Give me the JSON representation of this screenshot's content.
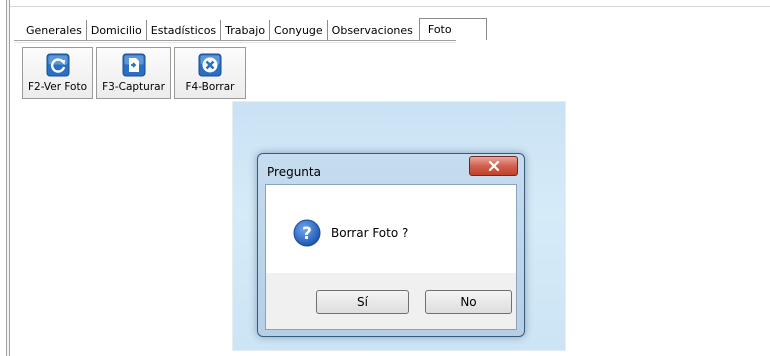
{
  "tabs": [
    "Generales",
    "Domicilio",
    "Estadísticos",
    "Trabajo",
    "Conyuge",
    "Observaciones",
    "Foto"
  ],
  "active_tab": "Foto",
  "toolbar": {
    "view_photo_label": "F2-Ver Foto",
    "capture_label": "F3-Capturar",
    "delete_label": "F4-Borrar"
  },
  "dialog": {
    "title": "Pregunta",
    "message": "Borrar Foto ?",
    "yes_label": "Sí",
    "no_label": "No"
  },
  "colors": {
    "photo_bg": "#cce4f5",
    "close_button": "#c94a36",
    "dialog_frame": "#b5cfe7"
  },
  "icons": {
    "view_photo": "refresh-photo-icon",
    "capture": "capture-document-icon",
    "delete": "delete-x-icon",
    "close": "close-icon",
    "question": "question-icon"
  }
}
